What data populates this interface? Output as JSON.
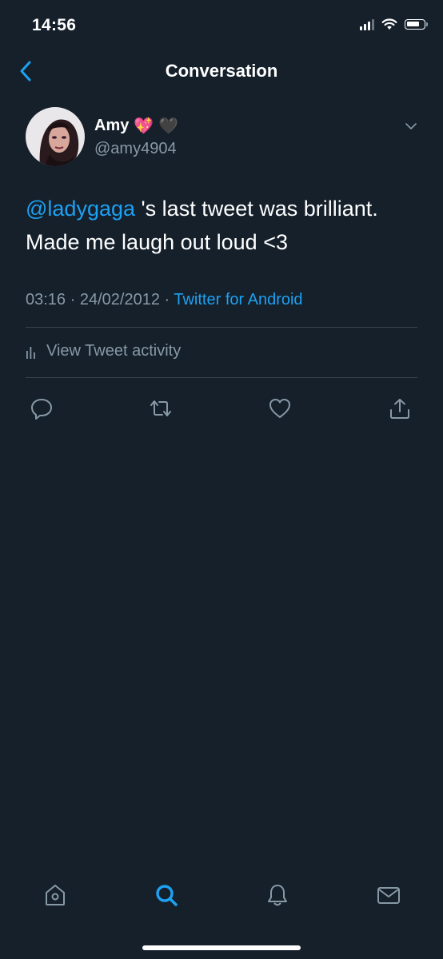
{
  "status_bar": {
    "time": "14:56",
    "icons": [
      "signal-icon",
      "wifi-icon",
      "battery-icon"
    ]
  },
  "nav": {
    "title": "Conversation",
    "back_icon": "chevron-left-icon"
  },
  "tweet": {
    "author_name": "Amy",
    "author_emojis": [
      "💖",
      "🖤"
    ],
    "handle": "@amy4904",
    "mention": "@ladygaga",
    "text_after_mention": " 's last tweet was brilliant. Made me laugh out loud <3",
    "time": "03:16",
    "date": "24/02/2012",
    "separator": " · ",
    "source": "Twitter for Android"
  },
  "activity": {
    "label": "View Tweet activity",
    "icon": "bar-chart-icon"
  },
  "actions": [
    "reply-icon",
    "retweet-icon",
    "like-icon",
    "share-icon"
  ],
  "tab_bar": {
    "active": "search",
    "tabs": [
      "home-icon",
      "search-icon",
      "notifications-icon",
      "messages-icon"
    ]
  },
  "colors": {
    "background": "#15202b",
    "accent": "#1da1f2",
    "secondary_text": "#8899a6",
    "divider": "#38444d"
  }
}
